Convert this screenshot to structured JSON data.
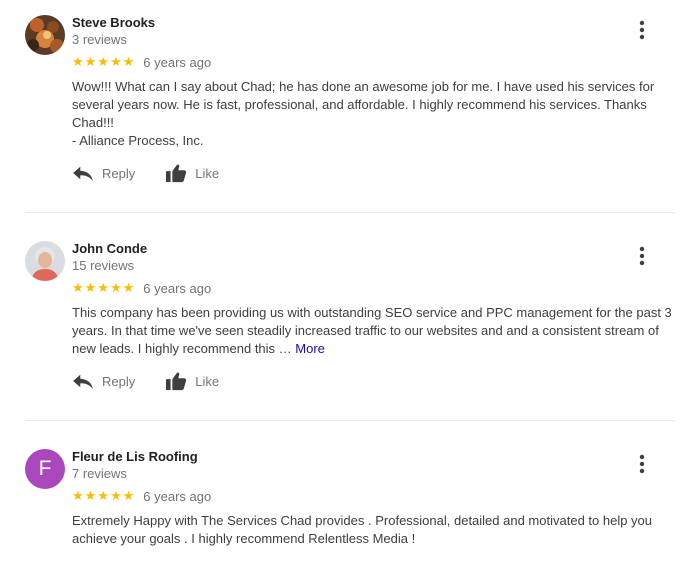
{
  "reviews": [
    {
      "name": "Steve Brooks",
      "count": "3 reviews",
      "stars": "★★★★★",
      "time": "6 years ago",
      "body_lines": [
        "Wow!!! What can I say about Chad; he has done an awesome job for me. I have used his services for",
        "several years now. He is fast, professional, and affordable. I highly recommend his services. Thanks",
        "Chad!!!",
        "- Alliance Process, Inc."
      ],
      "reply_label": "Reply",
      "like_label": "Like"
    },
    {
      "name": "John Conde",
      "count": "15 reviews",
      "stars": "★★★★★",
      "time": "6 years ago",
      "body_lines": [
        "This company has been providing us with outstanding SEO service and PPC management for the past 3",
        "years. In that time we've seen steadily increased traffic to our websites and  and a consistent stream of",
        "new leads. I highly recommend this …"
      ],
      "more_label": "More",
      "reply_label": "Reply",
      "like_label": "Like"
    },
    {
      "name": "Fleur de Lis Roofing",
      "avatar_letter": "F",
      "count": "7 reviews",
      "stars": "★★★★★",
      "time": "6 years ago",
      "body_lines": [
        "Extremely Happy with The Services Chad provides . Professional, detailed and motivated to help you",
        "achieve your goals . I highly recommend Relentless Media !"
      ]
    }
  ],
  "colors": {
    "star": "#fbbc04",
    "avatar_fleur": "#ab47bc",
    "link": "#1a0dab"
  },
  "icons": [
    "more-vert-icon",
    "reply-icon",
    "thumb-up-icon"
  ]
}
